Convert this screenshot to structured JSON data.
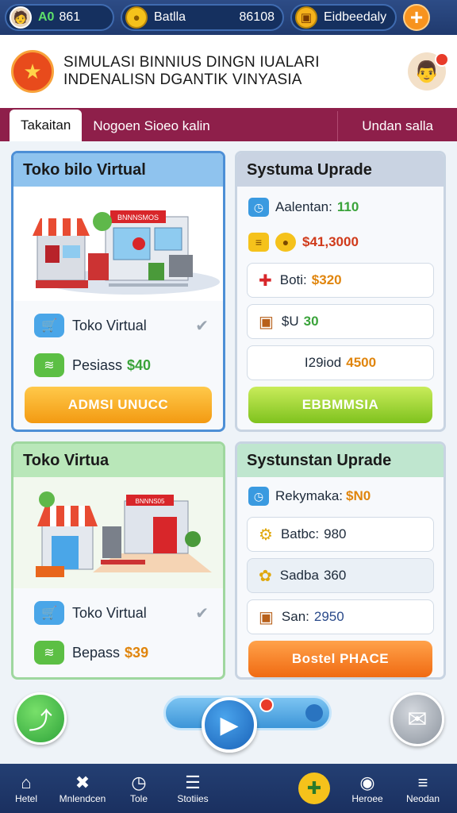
{
  "topbar": {
    "level": "A0",
    "user_code": "861",
    "coins_label": "Batlla",
    "coins_value": "86108",
    "shop_label": "Eidbeedaly",
    "plus": "+"
  },
  "header": {
    "title_line1": "SIMULASI BINNIUS DINGN IUALARI",
    "title_line2": "INDENALISN DGANTIK VINYASIA"
  },
  "tabs": [
    {
      "label": "Takaitan"
    },
    {
      "label": "Nogoen Sioeo kalin"
    },
    {
      "label": "Undan salla"
    }
  ],
  "cards": {
    "store1": {
      "title": "Toko bilo Virtual",
      "sign": "BNNNSMOS",
      "item1": "Toko Virtual",
      "item2": "Pesiass",
      "item2_value": "$40",
      "button": "ADMSI UNUCC"
    },
    "upgrade1": {
      "title": "Systuma Uprade",
      "stat1_label": "Aalentan:",
      "stat1_value": "110",
      "stat2_value": "$41,3000",
      "box1_label": "Boti:",
      "box1_value": "$320",
      "box2_label": "$U",
      "box2_value": "30",
      "box3_label": "I29iod",
      "box3_value": "4500",
      "button": "EBBMMSIA"
    },
    "store2": {
      "title": "Toko Virtua",
      "sign": "BNNNS05",
      "item1": "Toko Virtual",
      "item2": "Bepass",
      "item2_value": "$39",
      "button": ""
    },
    "upgrade2": {
      "title": "Systunstan Uprade",
      "stat1_label": "Rekymaka:",
      "stat1_value": "$N0",
      "box1_label": "Batbc:",
      "box1_value": "980",
      "box2_label": "Sadba",
      "box2_value": "360",
      "box3_label": "San:",
      "box3_value": "2950",
      "button": "Bostel PHACE"
    }
  },
  "nav": [
    {
      "label": "Hetel",
      "icon": "home-icon"
    },
    {
      "label": "Mnlendcen",
      "icon": "tools-icon"
    },
    {
      "label": "Tole",
      "icon": "clock-icon"
    },
    {
      "label": "Stotiies",
      "icon": "list-icon"
    },
    {
      "label": "",
      "icon": "map-icon"
    },
    {
      "label": "Heroee",
      "icon": "badge-icon"
    },
    {
      "label": "Neodan",
      "icon": "menu-icon"
    }
  ]
}
